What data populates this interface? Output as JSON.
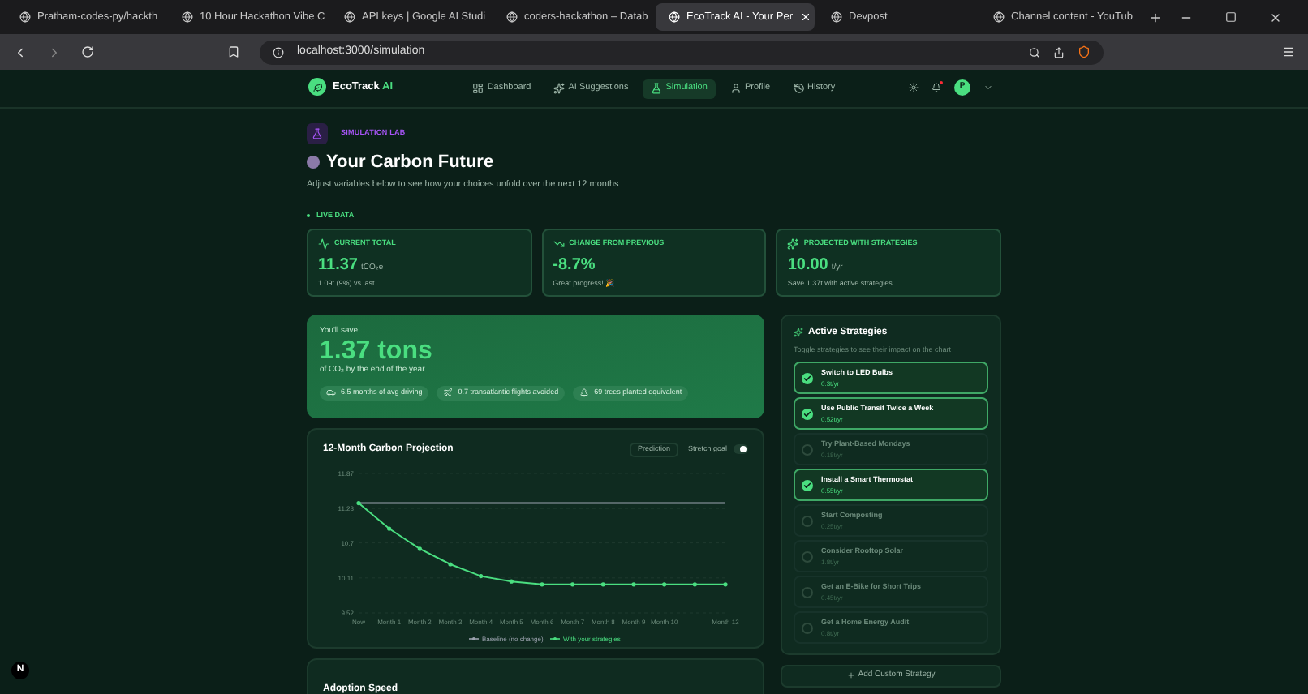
{
  "browser": {
    "tabs": [
      {
        "title": "Pratham-codes-py/hackth",
        "selected": false
      },
      {
        "title": "10 Hour Hackathon Vibe C",
        "selected": false
      },
      {
        "title": "API keys | Google AI Studi",
        "selected": false
      },
      {
        "title": "coders-hackathon – Datab",
        "selected": false
      },
      {
        "title": "EcoTrack AI - Your Per",
        "selected": true
      },
      {
        "title": "Devpost",
        "selected": false
      },
      {
        "title": "Channel content - YouTub",
        "selected": false
      }
    ],
    "url": "localhost:3000/simulation"
  },
  "nav": {
    "brand": "EcoTrack",
    "brand_suffix": "AI",
    "items": [
      {
        "label": "Dashboard",
        "selected": false
      },
      {
        "label": "AI Suggestions",
        "selected": false
      },
      {
        "label": "Simulation",
        "selected": true
      },
      {
        "label": "Profile",
        "selected": false
      },
      {
        "label": "History",
        "selected": false
      }
    ],
    "avatar": "P"
  },
  "header": {
    "badge": "SIMULATION LAB",
    "title": "Your Carbon Future",
    "subtitle": "Adjust variables below to see how your choices unfold over the next 12 months"
  },
  "live_label": "LIVE DATA",
  "stats": [
    {
      "label": "CURRENT TOTAL",
      "value": "11.37",
      "unit": "tCO₂e",
      "note": "1.09t (9%) vs last"
    },
    {
      "label": "CHANGE FROM PREVIOUS",
      "value": "-8.7%",
      "note": "Great progress! 🎉"
    },
    {
      "label": "PROJECTED WITH STRATEGIES",
      "value": "10.00",
      "unit": "t/yr",
      "note": "Save 1.37t with active strategies"
    }
  ],
  "savings": {
    "kicker": "You'll save",
    "amount": "1.37 tons",
    "caption": "of CO₂ by the end of the year",
    "chips": [
      "6.5 months of avg driving",
      "0.7 transatlantic flights avoided",
      "69 trees planted equivalent"
    ]
  },
  "projection": {
    "title": "12-Month Carbon Projection",
    "prediction_button": "Prediction",
    "stretch_label": "Stretch goal",
    "stretch_on": true,
    "chart_data": {
      "type": "line",
      "categories": [
        "Now",
        "Month 1",
        "Month 2",
        "Month 3",
        "Month 4",
        "Month 5",
        "Month 6",
        "Month 7",
        "Month 8",
        "Month 9",
        "Month 10",
        null,
        "Month 12"
      ],
      "yticks": [
        {
          "value": 9.52,
          "label": "9.52"
        },
        {
          "value": 10.11,
          "label": "10.11"
        },
        {
          "value": 10.7,
          "label": "10.7"
        },
        {
          "value": 11.28,
          "label": "11.28"
        },
        {
          "value": 11.87,
          "label": "11.87"
        }
      ],
      "ylim": [
        9.52,
        11.87
      ],
      "grid": true,
      "legend": "bottom",
      "series": [
        {
          "name": "Baseline (no change)",
          "color": "#9ca3af",
          "values": [
            11.37,
            11.37,
            11.37,
            11.37,
            11.37,
            11.37,
            11.37,
            11.37,
            11.37,
            11.37,
            11.37,
            11.37,
            11.37
          ]
        },
        {
          "name": "With your strategies",
          "color": "#4ade80",
          "values": [
            11.37,
            10.94,
            10.6,
            10.34,
            10.14,
            10.05,
            10.0,
            10.0,
            10.0,
            10.0,
            10.0,
            10.0,
            10.0
          ]
        }
      ]
    }
  },
  "adoption_title": "Adoption Speed",
  "strategies": {
    "title": "Active Strategies",
    "hint": "Toggle strategies to see their impact on the chart",
    "items": [
      {
        "name": "Switch to LED Bulbs",
        "saving": "0.3t/yr",
        "checked": true
      },
      {
        "name": "Use Public Transit Twice a Week",
        "saving": "0.52t/yr",
        "checked": true
      },
      {
        "name": "Try Plant-Based Mondays",
        "saving": "0.18t/yr",
        "checked": false
      },
      {
        "name": "Install a Smart Thermostat",
        "saving": "0.55t/yr",
        "checked": true
      },
      {
        "name": "Start Composting",
        "saving": "0.25t/yr",
        "checked": false
      },
      {
        "name": "Consider Rooftop Solar",
        "saving": "1.8t/yr",
        "checked": false
      },
      {
        "name": "Get an E-Bike for Short Trips",
        "saving": "0.45t/yr",
        "checked": false
      },
      {
        "name": "Get a Home Energy Audit",
        "saving": "0.8t/yr",
        "checked": false
      }
    ],
    "add_button": "Add Custom Strategy"
  },
  "dev_badge": "N"
}
